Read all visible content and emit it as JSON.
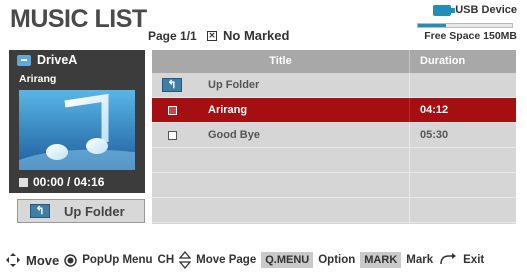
{
  "header": {
    "title": "MUSIC LIST",
    "page": "Page 1/1",
    "marked": "No Marked"
  },
  "usb": {
    "label": "USB Device",
    "free_space": "Free Space 150MB",
    "used_fraction": 0.3,
    "color": "#1f8fb8"
  },
  "now_playing": {
    "drive": "DriveA",
    "song": "Arirang",
    "time": "00:00 / 04:16"
  },
  "up_folder_button": "Up Folder",
  "list": {
    "columns": [
      "Title",
      "Duration"
    ],
    "rows": [
      {
        "type": "folder",
        "title": "Up Folder",
        "duration": ""
      },
      {
        "type": "file",
        "title": "Arirang",
        "duration": "04:12",
        "selected": true
      },
      {
        "type": "file",
        "title": "Good Bye",
        "duration": "05:30"
      }
    ],
    "selected_color": "#a50f12"
  },
  "footer": {
    "move": "Move",
    "popup_menu": "PopUp Menu",
    "ch": "CH",
    "move_page": "Move Page",
    "qmenu_key": "Q.MENU",
    "option": "Option",
    "mark_key": "MARK",
    "mark": "Mark",
    "exit": "Exit"
  }
}
